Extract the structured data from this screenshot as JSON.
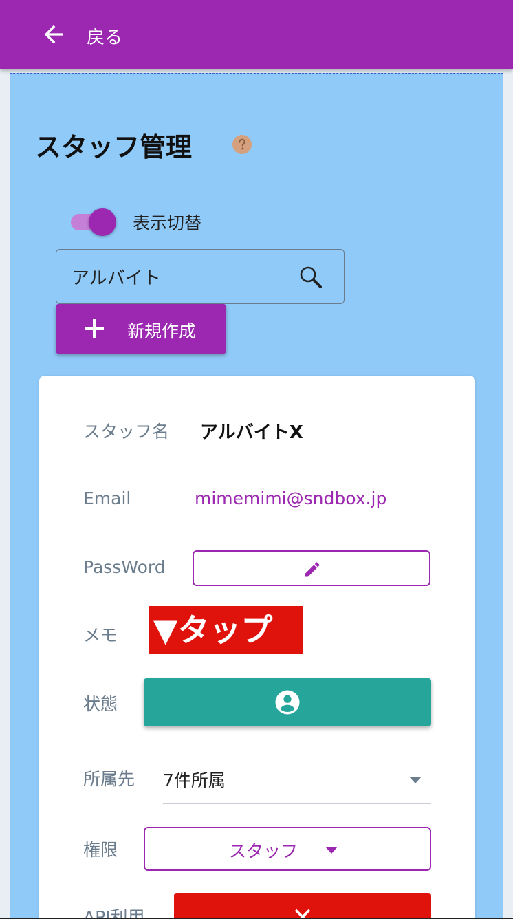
{
  "header": {
    "back_label": "戻る",
    "icon": "arrow-left-icon",
    "background": "#9c27b0"
  },
  "page": {
    "title": "スタッフ管理",
    "help_icon": "help-circle-icon",
    "toggle_label": "表示切替",
    "toggle_on": true
  },
  "search": {
    "value": "アルバイト",
    "icon": "search-icon"
  },
  "new_button": {
    "label": "新規作成",
    "icon": "plus-icon"
  },
  "card": {
    "rows": {
      "staff_name_label": "スタッフ名",
      "staff_name_value": "アルバイトX",
      "email_label": "Email",
      "email_value": "mimemimi@sndbox.jp",
      "password_label": "PassWord",
      "memo_label": "メモ",
      "status_label": "状態",
      "affiliation_label": "所属先",
      "affiliation_value": "7件所属",
      "role_label": "権限",
      "role_value": "スタッフ",
      "api_label": "API利用"
    },
    "tap_badge": "▼タップ"
  },
  "colors": {
    "accent": "#9c27b0",
    "content_bg": "#90caf9",
    "teal": "#26a69a",
    "red": "#e0130c"
  }
}
